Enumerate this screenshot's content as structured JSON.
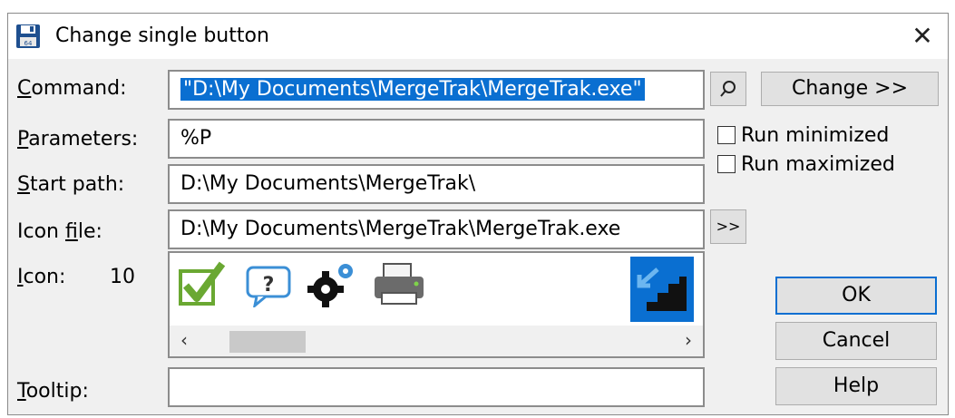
{
  "window": {
    "title": "Change single button",
    "close_glyph": "✕"
  },
  "labels": {
    "command": "Command:",
    "parameters": "Parameters:",
    "start_path": "Start path:",
    "icon_file": "Icon file:",
    "icon": "Icon:",
    "icon_index": "10",
    "tooltip": "Tooltip:"
  },
  "fields": {
    "command": "\"D:\\My Documents\\MergeTrak\\MergeTrak.exe\"",
    "parameters": "%P",
    "start_path": "D:\\My Documents\\MergeTrak\\",
    "icon_file": "D:\\My Documents\\MergeTrak\\MergeTrak.exe",
    "tooltip": ""
  },
  "buttons": {
    "change": "Change >>",
    "browse_icon": ">>",
    "ok": "OK",
    "cancel": "Cancel",
    "help": "Help"
  },
  "checkboxes": {
    "run_minimized": {
      "label": "Run minimized",
      "checked": false
    },
    "run_maximized": {
      "label": "Run maximized",
      "checked": false
    }
  },
  "icons": [
    {
      "name": "checkmark-icon",
      "selected": false
    },
    {
      "name": "help-bubble-icon",
      "selected": false
    },
    {
      "name": "gears-icon",
      "selected": false
    },
    {
      "name": "printer-icon",
      "selected": false
    },
    {
      "name": "mergetrak-stairs-icon",
      "selected": true
    }
  ],
  "scroll": {
    "left": "‹",
    "right": "›"
  },
  "colors": {
    "accent": "#0a6fd1",
    "selection_text": "#ffffff"
  }
}
